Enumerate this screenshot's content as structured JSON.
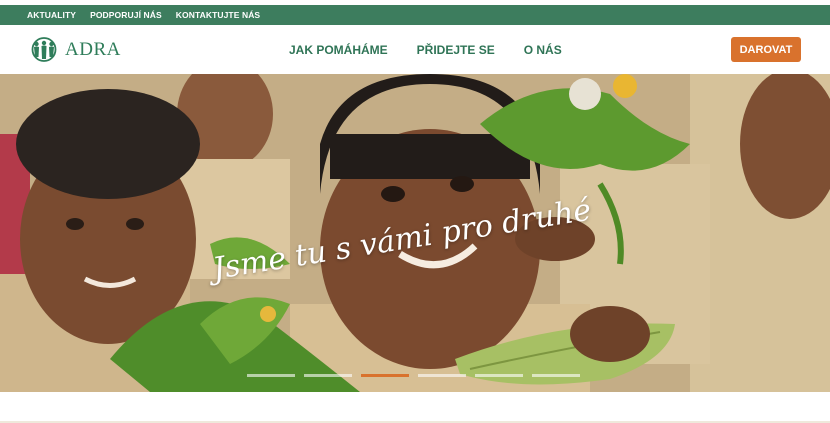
{
  "topbar": {
    "links": [
      "AKTUALITY",
      "PODPORUJÍ NÁS",
      "KONTAKTUJTE NÁS"
    ]
  },
  "header": {
    "logo_text": "ADRA",
    "logo_icon": "adra-people-globe-icon",
    "nav": [
      "JAK POMÁHÁME",
      "PŘIDEJTE SE",
      "O NÁS"
    ],
    "donate_label": "DAROVAT"
  },
  "hero": {
    "tagline": "Jsme tu s vámi pro druhé",
    "slides_count": 6,
    "active_slide_index": 2
  },
  "colors": {
    "topbar_bg": "#3d7d5e",
    "brand_green": "#2f7d5a",
    "donate_orange": "#d9722d"
  }
}
